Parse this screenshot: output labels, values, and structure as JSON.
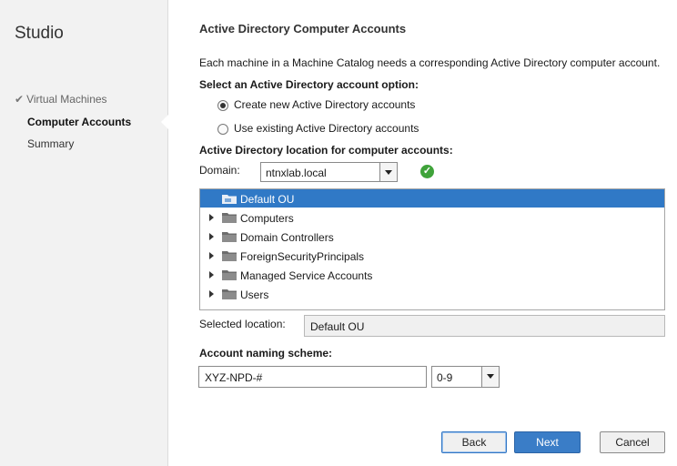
{
  "sidebar": {
    "title": "Studio",
    "steps": [
      {
        "label": "Virtual Machines",
        "state": "done"
      },
      {
        "label": "Computer Accounts",
        "state": "active"
      },
      {
        "label": "Summary",
        "state": "pending"
      }
    ],
    "check_glyph": "✔"
  },
  "main": {
    "heading": "Active Directory Computer Accounts",
    "intro": "Each machine in a Machine Catalog needs a corresponding Active Directory computer account.",
    "option_heading": "Select an Active Directory account option:",
    "options": [
      {
        "label": "Create new Active Directory accounts",
        "selected": true
      },
      {
        "label": "Use existing Active Directory accounts",
        "selected": false
      }
    ],
    "location_heading": "Active Directory location for computer accounts:",
    "domain_label": "Domain:",
    "domain_value": "ntnxlab.local",
    "domain_status": "valid",
    "tree": [
      {
        "label": "Default OU",
        "selected": true,
        "expandable": false
      },
      {
        "label": "Computers",
        "selected": false,
        "expandable": true
      },
      {
        "label": "Domain Controllers",
        "selected": false,
        "expandable": true
      },
      {
        "label": "ForeignSecurityPrincipals",
        "selected": false,
        "expandable": true
      },
      {
        "label": "Managed Service Accounts",
        "selected": false,
        "expandable": true
      },
      {
        "label": "Users",
        "selected": false,
        "expandable": true
      }
    ],
    "selected_location_label": "Selected location:",
    "selected_location_value": "Default OU",
    "naming_heading": "Account naming scheme:",
    "naming_value": "XYZ-NPD-#",
    "naming_type": "0-9"
  },
  "buttons": {
    "back": "Back",
    "next": "Next",
    "cancel": "Cancel"
  },
  "colors": {
    "selection": "#3079c6",
    "primary_button": "#3a7dc7",
    "ok_green": "#3fa33a"
  }
}
